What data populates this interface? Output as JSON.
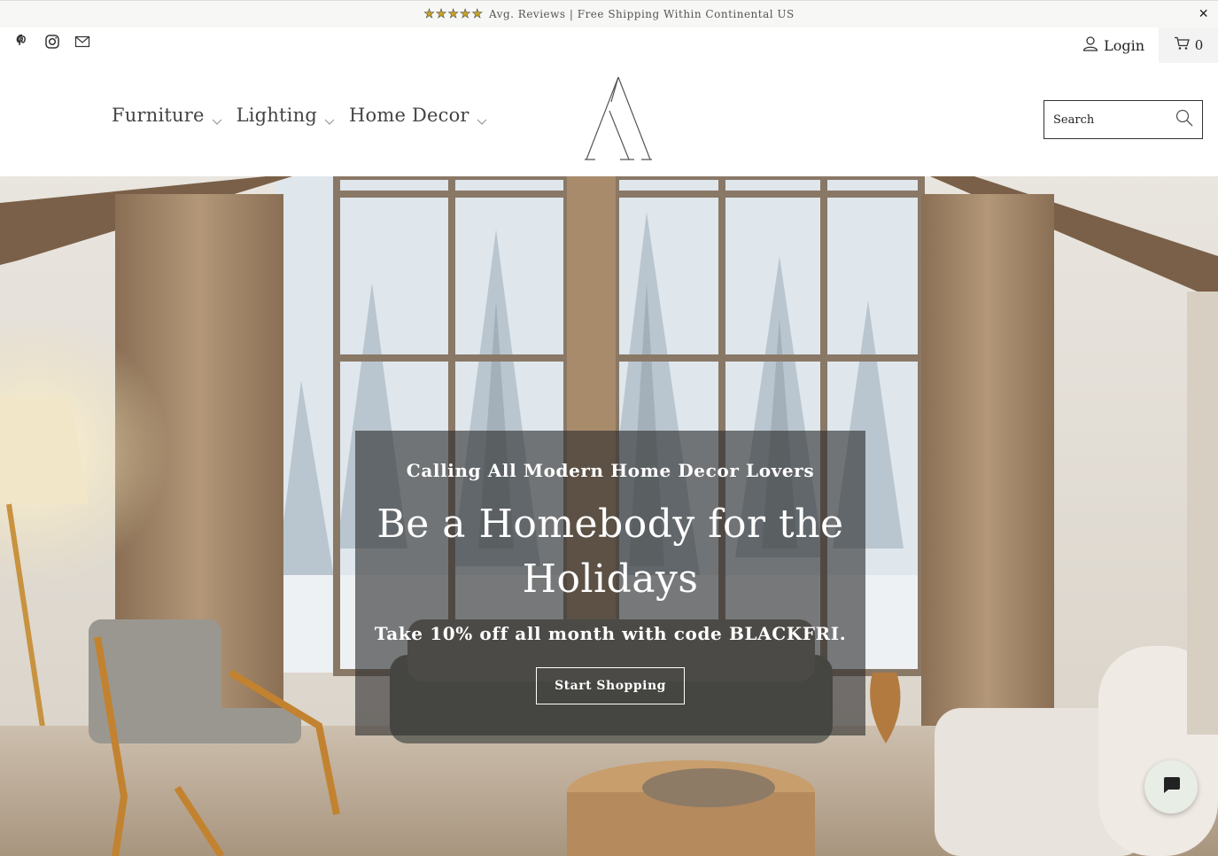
{
  "announcement": {
    "stars": "★★★★★",
    "text": "Avg. Reviews | Free Shipping Within Continental US",
    "close": "✕"
  },
  "social": {
    "icons": [
      "pinterest-icon",
      "instagram-icon",
      "mail-icon"
    ]
  },
  "account": {
    "login_label": "Login",
    "cart_count": "0"
  },
  "nav": {
    "items": [
      {
        "label": "Furniture"
      },
      {
        "label": "Lighting"
      },
      {
        "label": "Home Decor"
      }
    ]
  },
  "search": {
    "placeholder": "Search"
  },
  "hero": {
    "subtitle": "Calling All Modern Home Decor Lovers",
    "title": "Be a Homebody for the Holidays",
    "promo": "Take 10% off all month with code BLACKFRI.",
    "cta": "Start Shopping"
  },
  "colors": {
    "accent": "#c9a227",
    "overlay": "#2d2d2d",
    "chat_bg": "#e8eee6"
  }
}
